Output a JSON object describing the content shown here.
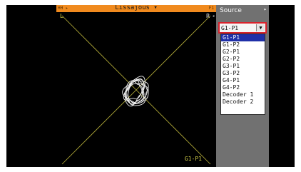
{
  "scope": {
    "title": "Lissajous",
    "title_dropdown_glyph": "▾",
    "left_tag": "HH ▸",
    "right_tag": "F1",
    "channel_left": "L",
    "channel_right": "R",
    "channel_right_glyph": "◂",
    "source_label": "G1-P1"
  },
  "panel": {
    "title": "Source",
    "arrow": "▸",
    "select": {
      "value": "G1-P1",
      "button_glyph": "▼"
    },
    "options": [
      {
        "label": "G1-P1",
        "selected": true
      },
      {
        "label": "G1-P2",
        "selected": false
      },
      {
        "label": "G2-P1",
        "selected": false
      },
      {
        "label": "G2-P2",
        "selected": false
      },
      {
        "label": "G3-P1",
        "selected": false
      },
      {
        "label": "G3-P2",
        "selected": false
      },
      {
        "label": "G4-P1",
        "selected": false
      },
      {
        "label": "G4-P2",
        "selected": false
      },
      {
        "label": "Decoder 1",
        "selected": false
      },
      {
        "label": "Decoder 2",
        "selected": false
      }
    ]
  },
  "colors": {
    "accent_bar": "#f08a1e",
    "axis_lines": "#b8b03a",
    "trace": "#f2f2f2",
    "selection": "#1f2fa8",
    "select_border": "#d8222c",
    "panel_bg": "#717171"
  }
}
